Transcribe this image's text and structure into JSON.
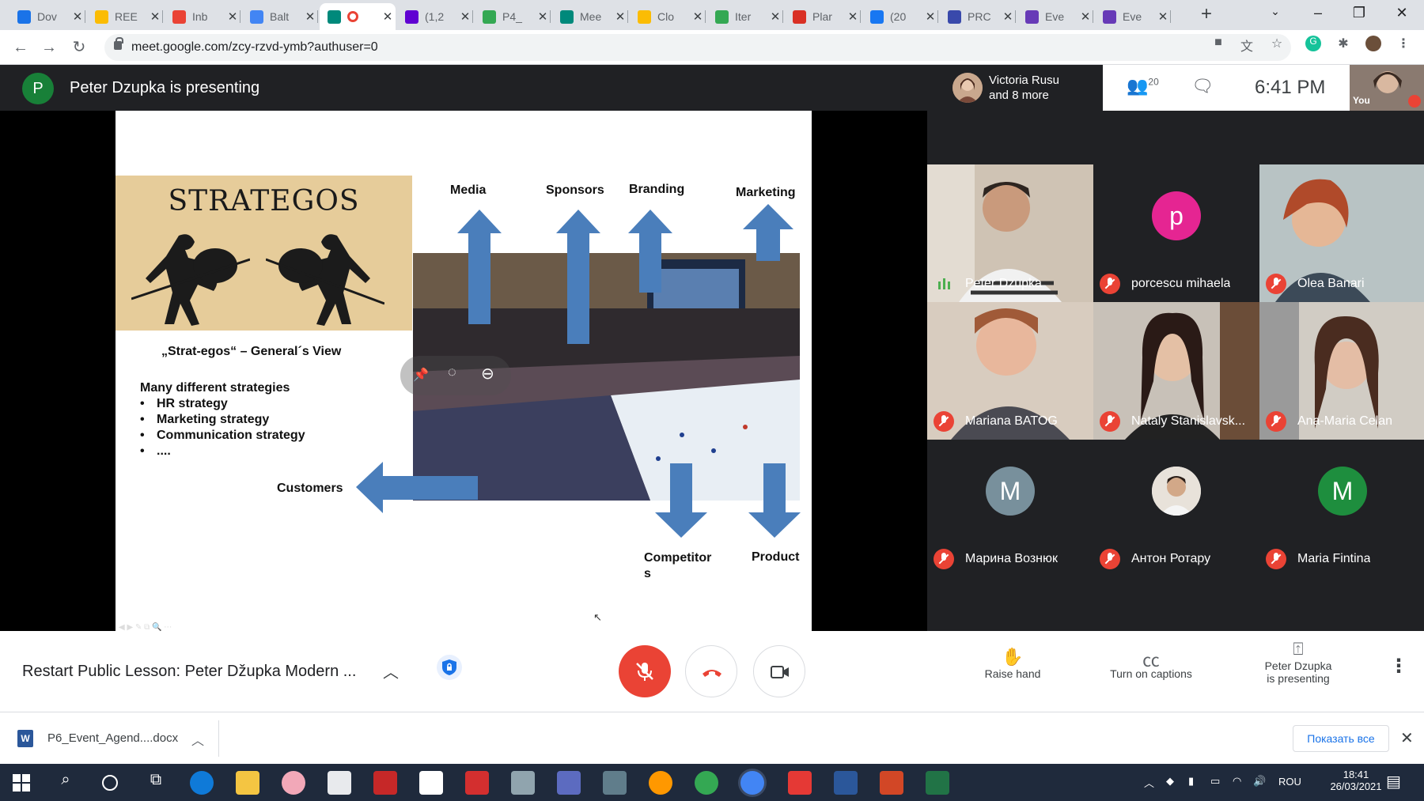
{
  "browser": {
    "tabs": [
      {
        "title": "Dov",
        "color": "#1a73e8"
      },
      {
        "title": "REE",
        "color": "#fbbc04"
      },
      {
        "title": "Inb",
        "color": "#ea4335"
      },
      {
        "title": "Balt",
        "color": "#4285f4"
      },
      {
        "title": "",
        "color": "#00897b",
        "active": true
      },
      {
        "title": "(1,2",
        "color": "#6001d2"
      },
      {
        "title": "P4_",
        "color": "#34a853"
      },
      {
        "title": "Mee",
        "color": "#00897b"
      },
      {
        "title": "Clo",
        "color": "#fbbc04"
      },
      {
        "title": "Iter",
        "color": "#34a853"
      },
      {
        "title": "Plar",
        "color": "#d93025"
      },
      {
        "title": "(20",
        "color": "#1877f2"
      },
      {
        "title": "PRC",
        "color": "#3949ab"
      },
      {
        "title": "Eve",
        "color": "#673ab7"
      },
      {
        "title": "Eve",
        "color": "#673ab7"
      }
    ],
    "url": "meet.google.com/zcy-rzvd-ymb?authuser=0"
  },
  "meet": {
    "presenter_initial": "P",
    "presenting_title": "Peter Dzupka is presenting",
    "speaker_chip": {
      "line1": "Victoria Rusu",
      "line2": "and 8 more"
    },
    "people_count": "20",
    "time": "6:41 PM",
    "self_label": "You"
  },
  "slide": {
    "strategos_title": "STRATEGOS",
    "labels": {
      "media": "Media",
      "sponsors": "Sponsors",
      "branding": "Branding",
      "marketing": "Marketing",
      "customers": "Customers",
      "competitors_1": "Competitor",
      "competitors_2": "s",
      "product": "Product"
    },
    "general_view": "„Strat-egos“ – General´s View",
    "strategies_heading": "Many different strategies",
    "strategies": [
      "HR strategy",
      "Marketing strategy",
      "Communication strategy",
      "...."
    ],
    "colors": {
      "arrow": "#4a7ebb",
      "box": "#e6cc9a"
    }
  },
  "participants": [
    {
      "name": "Peter Dzupka",
      "muted": false,
      "speaking": true,
      "type": "video"
    },
    {
      "name": "porcescu mihaela",
      "muted": true,
      "type": "avatar",
      "initial": "p",
      "color": "#e52592"
    },
    {
      "name": "Olea Banari",
      "muted": true,
      "type": "video"
    },
    {
      "name": "Mariana BATOG",
      "muted": true,
      "type": "video"
    },
    {
      "name": "Nataly Stanislavsk...",
      "muted": true,
      "type": "video"
    },
    {
      "name": "Ana-Maria Celan",
      "muted": true,
      "type": "video"
    },
    {
      "name": "Марина Вознюк",
      "muted": true,
      "type": "avatar",
      "initial": "M",
      "color": "#78909c"
    },
    {
      "name": "Антон Ротару",
      "muted": true,
      "type": "photo"
    },
    {
      "name": "Maria Fintina",
      "muted": true,
      "type": "avatar",
      "initial": "M",
      "color": "#1e8e3e"
    }
  ],
  "bottom": {
    "meeting_title": "Restart Public Lesson: Peter Džupka Modern ...",
    "raise_hand": "Raise hand",
    "captions": "Turn on captions",
    "presenting_1": "Peter Dzupka",
    "presenting_2": "is presenting"
  },
  "downloads": {
    "file": "P6_Event_Agend....docx",
    "show_all": "Показать все"
  },
  "taskbar": {
    "lang": "ROU",
    "time": "18:41",
    "date": "26/03/2021"
  }
}
